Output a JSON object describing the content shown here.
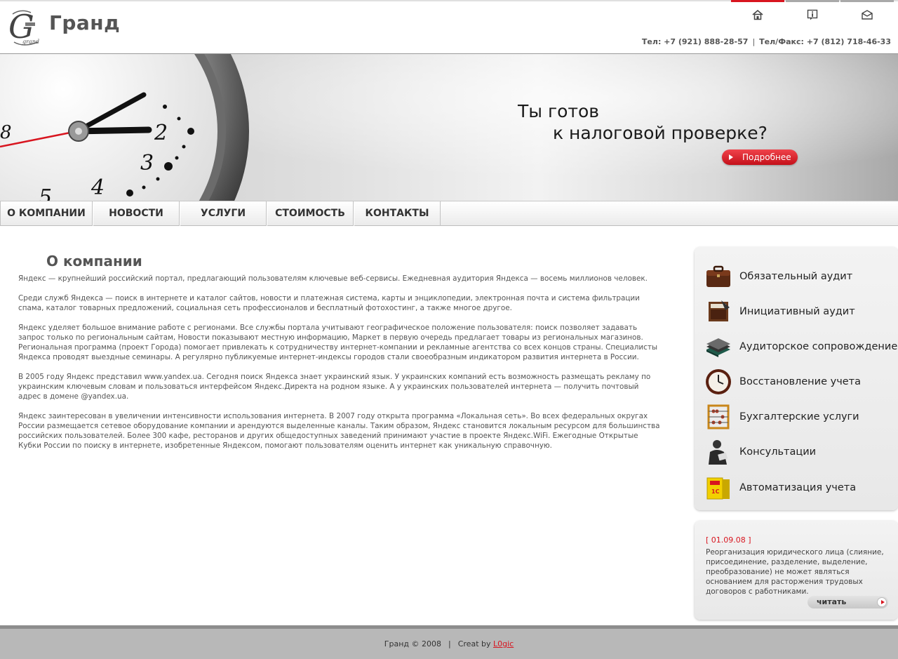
{
  "header": {
    "logo_text": "Гранд",
    "phone_1": "Тел: +7 (921) 888-28-57",
    "phone_separator": "|",
    "phone_2": "Тел/Факс: +7 (812) 718-46-33",
    "top_icons": [
      "home-icon",
      "info-icon",
      "mail-icon"
    ]
  },
  "banner": {
    "title_line1": "Ты готов",
    "title_line2": "к налоговой проверке?",
    "more_label": "Подробнее"
  },
  "nav": {
    "items": [
      {
        "label": "О КОМПАНИИ"
      },
      {
        "label": "НОВОСТИ"
      },
      {
        "label": "УСЛУГИ"
      },
      {
        "label": "СТОИМОСТЬ"
      },
      {
        "label": "КОНТАКТЫ"
      }
    ]
  },
  "main": {
    "title": "О компании",
    "paragraphs": [
      "Яндекс — крупнейший российский портал, предлагающий пользователям ключевые веб-сервисы. Ежедневная аудитория Яндекса — восемь миллионов человек.",
      "Среди служб Яндекса — поиск в интернете и каталог сайтов, новости и платежная система, карты и энциклопедии, электронная почта и система фильтрации спама, каталог товарных предложений, социальная сеть профессионалов и бесплатный фотохостинг, а также многое другое.",
      "Яндекс уделяет большое внимание работе с регионами. Все службы портала учитывают географическое положение пользователя: поиск позволяет задавать запрос только по региональным сайтам, Новости показывают местную информацию, Маркет в первую очередь предлагает товары из региональных магазинов. Региональная программа (проект Города) помогает привлекать к сотрудничеству интернет-компании и рекламные агентства со всех концов страны. Специалисты Яндекса проводят выездные семинары. А регулярно публикуемые интернет-индексы городов стали своеобразным индикатором развития интернета в России.",
      "В 2005 году Яндекс представил www.yandex.ua. Сегодня поиск Яндекса знает украинский язык. У украинских компаний есть возможность размещать рекламу по украинским ключевым словам и пользоваться интерфейсом Яндекс.Директа на родном языке. А у украинских пользователей интернета — получить почтовый адрес в домене @yandex.ua.",
      "Яндекс заинтересован в увеличении интенсивности использования интернета. В 2007 году открыта программа «Локальная сеть». Во всех федеральных округах России размещается сетевое оборудование компании и арендуются выделенные каналы. Таким образом, Яндекс становится локальным ресурсом для большинства российских пользователей. Более 300 кафе, ресторанов и других общедоступных заведений принимают участие в проекте Яндекс.WiFi. Ежегодные Открытые Кубки России по поиску в интернете, изобретенные Яндексом, помогают пользователям оценить интернет как уникальную справочную."
    ]
  },
  "services": {
    "items": [
      {
        "label": "Обязательный аудит",
        "icon": "briefcase-icon"
      },
      {
        "label": "Инициативный аудит",
        "icon": "folder-icon"
      },
      {
        "label": "Аудиторское сопровождение",
        "icon": "books-icon"
      },
      {
        "label": "Восстановление учета",
        "icon": "clock-icon"
      },
      {
        "label": "Бухгалтерские услуги",
        "icon": "abacus-icon"
      },
      {
        "label": "Консультации",
        "icon": "consultant-icon"
      },
      {
        "label": "Автоматизация учета",
        "icon": "software-box-icon"
      }
    ]
  },
  "news": {
    "date": "[ 01.09.08 ]",
    "text": "Реорганизация юридического лица (слияние, присоединение, разделение, выделение, преобразование) не может являться основанием для расторжения трудовых договоров с работниками.",
    "read_label": "читать"
  },
  "footer": {
    "copyright": "Гранд © 2008",
    "separator": "|",
    "created_by": "Creat by",
    "author_link": "L0gic"
  },
  "colors": {
    "accent": "#d8151f",
    "footer_bg": "#b8b8b8",
    "text": "#555555"
  }
}
